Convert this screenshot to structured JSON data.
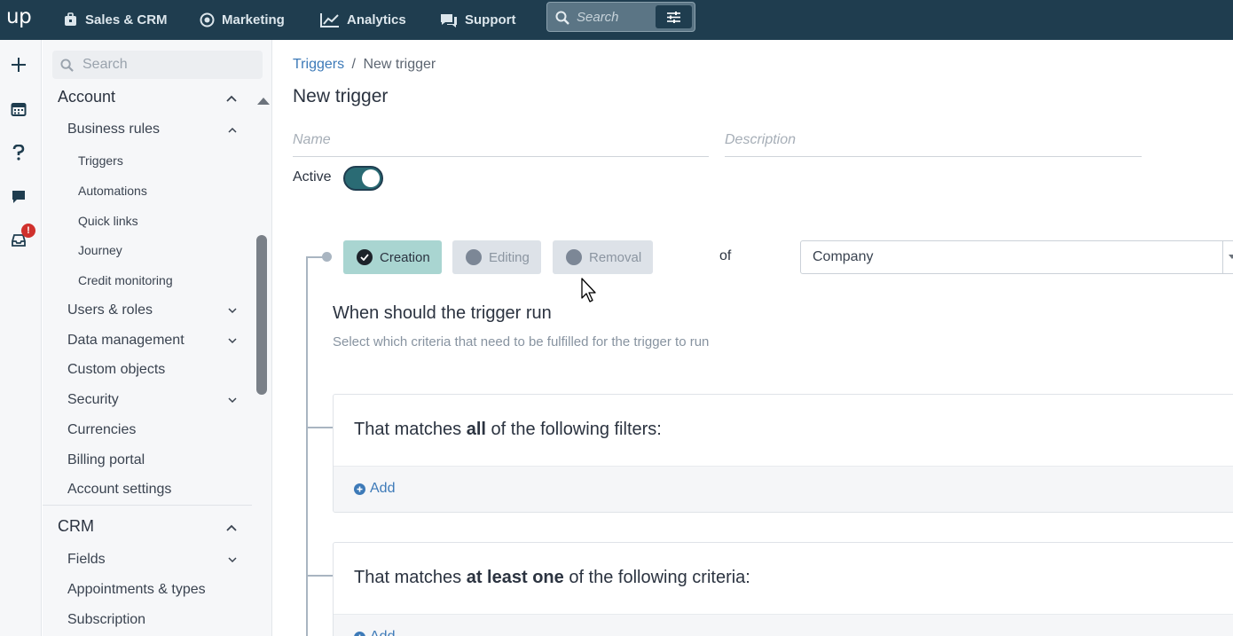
{
  "topbar": {
    "logo": "up",
    "nav": [
      {
        "label": "Sales & CRM",
        "icon": "briefcase-icon"
      },
      {
        "label": "Marketing",
        "icon": "target-icon"
      },
      {
        "label": "Analytics",
        "icon": "line-chart-icon"
      },
      {
        "label": "Support",
        "icon": "chat-bubbles-icon"
      }
    ],
    "search_placeholder": "Search"
  },
  "rail": {
    "icons": [
      "plus-icon",
      "calendar-icon",
      "question-icon",
      "chat-icon",
      "inbox-icon"
    ],
    "alert_badge": "!"
  },
  "sidebar": {
    "search_placeholder": "Search",
    "account": {
      "label": "Account",
      "business_rules": {
        "label": "Business rules",
        "items": [
          "Triggers",
          "Automations",
          "Quick links",
          "Journey",
          "Credit monitoring"
        ]
      },
      "items": [
        "Users & roles",
        "Data management",
        "Custom objects",
        "Security",
        "Currencies",
        "Billing portal",
        "Account settings"
      ]
    },
    "crm": {
      "label": "CRM",
      "items": [
        "Fields",
        "Appointments & types",
        "Subscription"
      ]
    }
  },
  "main": {
    "breadcrumb": {
      "parent": "Triggers",
      "separator": "/",
      "current": "New trigger"
    },
    "title": "New trigger",
    "name_placeholder": "Name",
    "description_placeholder": "Description",
    "active_label": "Active",
    "active_on": true,
    "events": [
      {
        "label": "Creation",
        "selected": true
      },
      {
        "label": "Editing",
        "selected": false
      },
      {
        "label": "Removal",
        "selected": false
      }
    ],
    "of_label": "of",
    "entity_value": "Company",
    "section_title": "When should the trigger run",
    "section_subtitle": "Select which criteria that need to be fulfilled for the trigger to run",
    "filter_all": {
      "prefix": "That matches ",
      "bold": "all",
      "suffix": " of the following filters:",
      "add_label": "Add"
    },
    "filter_any": {
      "prefix": "That matches ",
      "bold": "at least one",
      "suffix": " of the following criteria:",
      "add_label": "Add"
    }
  },
  "colors": {
    "topbar": "#1f3d4f",
    "accent_teal": "#a9d5d1",
    "link_blue": "#3d7ab8",
    "badge_red": "#d0312d"
  }
}
